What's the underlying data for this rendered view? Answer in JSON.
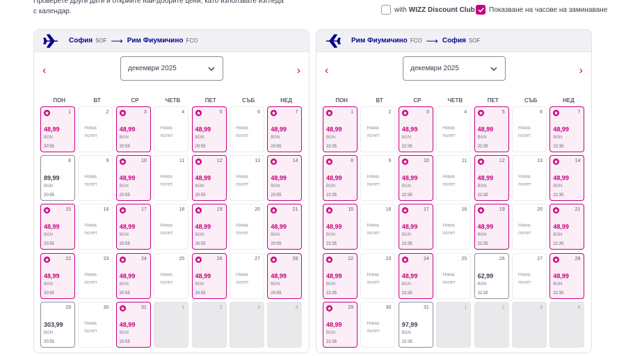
{
  "header": {
    "intro": "Проверете други дати и открийте най-добрите цени, като използвате изгледа с календар.",
    "discount_prefix": "with",
    "discount_brand": "WIZZ Discount Club",
    "discount_checked": false,
    "show_times_label": "Показване на часове на заминаване",
    "show_times_checked": true
  },
  "weekdays": [
    "ПОН",
    "ВТ",
    "СР",
    "ЧЕТВ",
    "ПЕТ",
    "СЪБ",
    "НЕД"
  ],
  "no_flight_text": "Няма полет",
  "currency": "BGN",
  "panels": [
    {
      "id": "left",
      "from_city": "София",
      "from_code": "SOF",
      "to_city": "Рим Фиумичино",
      "to_code": "FCO",
      "month": "декември 2025",
      "cells": [
        {
          "day": "1",
          "type": "flight",
          "price": "48,99",
          "time": "20:55"
        },
        {
          "day": "2",
          "type": "noflight"
        },
        {
          "day": "3",
          "type": "flight",
          "price": "48,99",
          "time": "20:55"
        },
        {
          "day": "4",
          "type": "noflight"
        },
        {
          "day": "5",
          "type": "flight",
          "price": "48,99",
          "time": "20:55"
        },
        {
          "day": "6",
          "type": "noflight"
        },
        {
          "day": "7",
          "type": "flight",
          "price": "48,99",
          "time": "20:55"
        },
        {
          "day": "8",
          "type": "plain",
          "price": "89,99",
          "time": "20:55"
        },
        {
          "day": "9",
          "type": "noflight"
        },
        {
          "day": "10",
          "type": "flight",
          "price": "48,99",
          "time": "20:55"
        },
        {
          "day": "11",
          "type": "noflight"
        },
        {
          "day": "12",
          "type": "flight",
          "price": "48,99",
          "time": "20:55"
        },
        {
          "day": "13",
          "type": "noflight"
        },
        {
          "day": "14",
          "type": "flight",
          "price": "48,99",
          "time": "20:55"
        },
        {
          "day": "15",
          "type": "flight",
          "price": "48,99",
          "time": "20:55"
        },
        {
          "day": "16",
          "type": "noflight"
        },
        {
          "day": "17",
          "type": "flight",
          "price": "48,99",
          "time": "20:55"
        },
        {
          "day": "18",
          "type": "noflight"
        },
        {
          "day": "19",
          "type": "flight",
          "price": "48,99",
          "time": "20:55"
        },
        {
          "day": "20",
          "type": "noflight"
        },
        {
          "day": "21",
          "type": "flight",
          "price": "48,99",
          "time": "20:55"
        },
        {
          "day": "22",
          "type": "flight",
          "price": "48,99",
          "time": "20:55"
        },
        {
          "day": "23",
          "type": "noflight"
        },
        {
          "day": "24",
          "type": "flight",
          "price": "48,99",
          "time": "20:55"
        },
        {
          "day": "25",
          "type": "noflight"
        },
        {
          "day": "26",
          "type": "flight",
          "price": "48,99",
          "time": "20:55"
        },
        {
          "day": "27",
          "type": "noflight"
        },
        {
          "day": "28",
          "type": "flight",
          "price": "48,99",
          "time": "20:55"
        },
        {
          "day": "29",
          "type": "plain",
          "price": "303,99",
          "time": "20:55"
        },
        {
          "day": "30",
          "type": "noflight"
        },
        {
          "day": "31",
          "type": "flight",
          "price": "48,99",
          "time": "20:55"
        },
        {
          "day": "1",
          "type": "empty"
        },
        {
          "day": "2",
          "type": "empty"
        },
        {
          "day": "3",
          "type": "empty"
        },
        {
          "day": "4",
          "type": "empty"
        }
      ]
    },
    {
      "id": "right",
      "from_city": "Рим Фиумичино",
      "from_code": "FCO",
      "to_city": "София",
      "to_code": "SOF",
      "month": "декември 2025",
      "cells": [
        {
          "day": "1",
          "type": "flight",
          "price": "48,99",
          "time": "22:35"
        },
        {
          "day": "2",
          "type": "noflight"
        },
        {
          "day": "3",
          "type": "flight",
          "price": "48,99",
          "time": "22:35"
        },
        {
          "day": "4",
          "type": "noflight"
        },
        {
          "day": "5",
          "type": "flight",
          "price": "48,99",
          "time": "22:35"
        },
        {
          "day": "6",
          "type": "noflight"
        },
        {
          "day": "7",
          "type": "flight",
          "price": "48,99",
          "time": "22:35"
        },
        {
          "day": "8",
          "type": "flight",
          "price": "48,99",
          "time": "22:35"
        },
        {
          "day": "9",
          "type": "noflight"
        },
        {
          "day": "10",
          "type": "flight",
          "price": "48,99",
          "time": "22:35"
        },
        {
          "day": "11",
          "type": "noflight"
        },
        {
          "day": "12",
          "type": "flight",
          "price": "48,99",
          "time": "22:35"
        },
        {
          "day": "13",
          "type": "noflight"
        },
        {
          "day": "14",
          "type": "flight",
          "price": "48,99",
          "time": "22:35"
        },
        {
          "day": "15",
          "type": "flight",
          "price": "48,99",
          "time": "22:35"
        },
        {
          "day": "16",
          "type": "noflight"
        },
        {
          "day": "17",
          "type": "flight",
          "price": "48,99",
          "time": "22:35"
        },
        {
          "day": "18",
          "type": "noflight"
        },
        {
          "day": "19",
          "type": "flight",
          "price": "48,99",
          "time": "22:35"
        },
        {
          "day": "20",
          "type": "noflight"
        },
        {
          "day": "21",
          "type": "flight",
          "price": "48,99",
          "time": "22:35"
        },
        {
          "day": "22",
          "type": "flight",
          "price": "48,99",
          "time": "22:35"
        },
        {
          "day": "23",
          "type": "noflight"
        },
        {
          "day": "24",
          "type": "flight",
          "price": "48,99",
          "time": "22:35"
        },
        {
          "day": "25",
          "type": "noflight"
        },
        {
          "day": "26",
          "type": "plain",
          "price": "62,99",
          "time": "22:35"
        },
        {
          "day": "27",
          "type": "noflight"
        },
        {
          "day": "28",
          "type": "flight",
          "price": "48,99",
          "time": "22:35"
        },
        {
          "day": "29",
          "type": "flight",
          "price": "48,99",
          "time": "22:35"
        },
        {
          "day": "30",
          "type": "noflight"
        },
        {
          "day": "31",
          "type": "plain",
          "price": "97,99",
          "time": "22:35"
        },
        {
          "day": "1",
          "type": "empty"
        },
        {
          "day": "2",
          "type": "empty"
        },
        {
          "day": "3",
          "type": "empty"
        },
        {
          "day": "4",
          "type": "empty"
        }
      ]
    }
  ],
  "colors": {
    "brand_magenta": "#c6007e",
    "brand_navy": "#06038d"
  }
}
